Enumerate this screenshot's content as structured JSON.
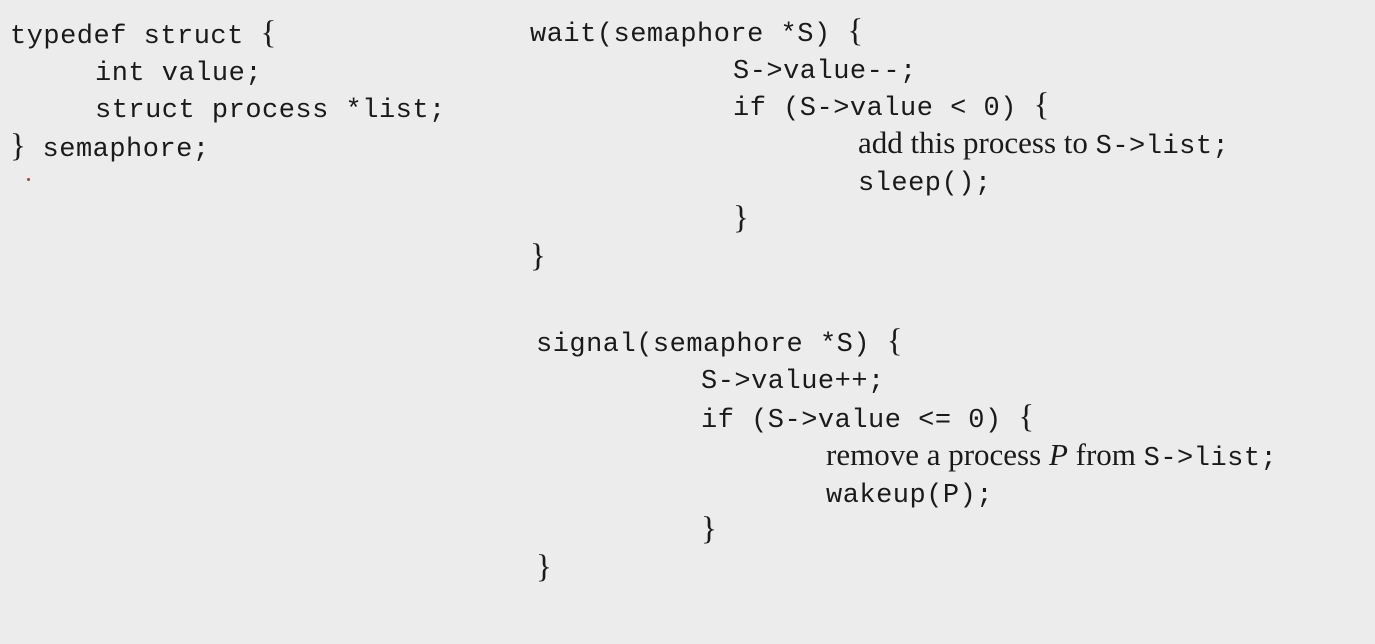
{
  "struct_block": {
    "line1_code": "typedef struct ",
    "line1_brace": "{",
    "line2": "int value;",
    "line3": "struct process *list;",
    "line4_brace": "}",
    "line4_code": " semaphore;"
  },
  "wait_block": {
    "signature": "wait(semaphore *S) ",
    "open_brace": "{",
    "decrement": "S->value--;",
    "if_cond": "if (S->value < 0) ",
    "if_open": "{",
    "add_text": "add this process to ",
    "add_code": "S->list;",
    "sleep": "sleep();",
    "if_close": "}",
    "close_brace": "}"
  },
  "signal_block": {
    "signature": "signal(semaphore *S) ",
    "open_brace": "{",
    "increment": "S->value++;",
    "if_cond": "if (S->value <= 0) ",
    "if_open": "{",
    "remove_text_1": "remove a process ",
    "remove_var": "P",
    "remove_text_2": " from ",
    "remove_code": "S->list;",
    "wakeup": "wakeup(P);",
    "if_close": "}",
    "close_brace": "}"
  },
  "colors": {
    "background": "#ececec",
    "text": "#1a1a1a",
    "stray_mark": "#c0392b"
  }
}
